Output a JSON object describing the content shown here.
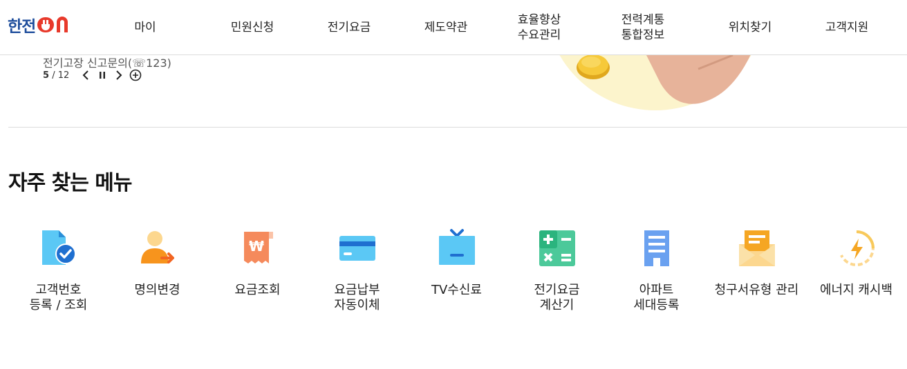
{
  "header": {
    "logo_text": "한전",
    "logo_suffix": "ON",
    "nav": [
      {
        "label": "마이"
      },
      {
        "label": "민원신청"
      },
      {
        "label": "전기요금"
      },
      {
        "label": "제도약관"
      },
      {
        "label": "효율향상\n수요관리"
      },
      {
        "label": "전력계통\n통합정보"
      },
      {
        "label": "위치찾기"
      },
      {
        "label": "고객지원"
      }
    ]
  },
  "hero": {
    "caption": "전기고장 신고문의(☏123)",
    "current": "5",
    "separator": "/",
    "total": "12"
  },
  "quick_menu": {
    "title": "자주 찾는 메뉴",
    "items": [
      {
        "label": "고객번호\n등록 / 조회",
        "icon": "document-check-icon"
      },
      {
        "label": "명의변경",
        "icon": "user-transfer-icon"
      },
      {
        "label": "요금조회",
        "icon": "won-receipt-icon"
      },
      {
        "label": "요금납부\n자동이체",
        "icon": "credit-card-icon"
      },
      {
        "label": "TV수신료",
        "icon": "tv-icon"
      },
      {
        "label": "전기요금\n계산기",
        "icon": "calculator-icon"
      },
      {
        "label": "아파트\n세대등록",
        "icon": "apartment-icon"
      },
      {
        "label": "청구서유형 관리",
        "icon": "envelope-icon"
      },
      {
        "label": "에너지 캐시백",
        "icon": "energy-cashback-icon"
      }
    ]
  }
}
